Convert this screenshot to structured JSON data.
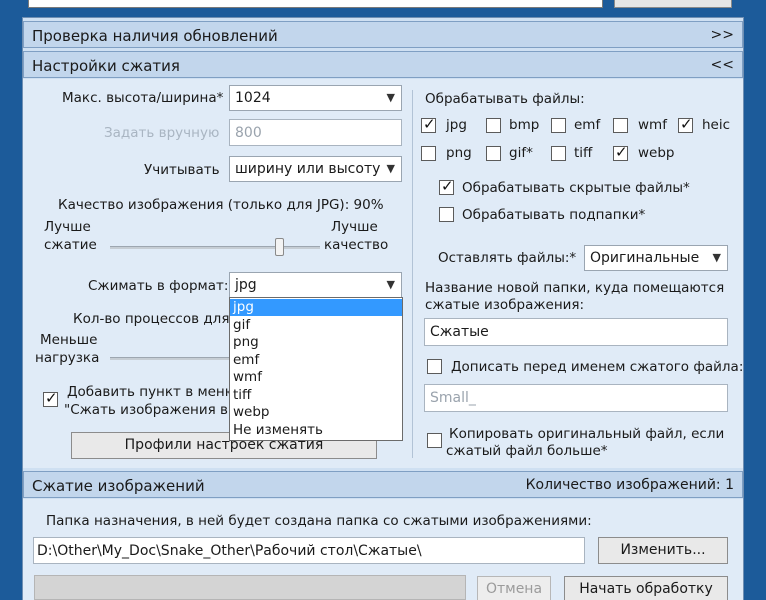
{
  "sections": {
    "updates": {
      "title": "Проверка наличия обновлений",
      "toggle": ">>"
    },
    "settings": {
      "title": "Настройки сжатия",
      "toggle": "<<"
    },
    "compress": {
      "title": "Сжатие изображений",
      "count_label": "Количество изображений: 1"
    }
  },
  "left": {
    "max_size_label": "Макс. высота/ширина*",
    "max_size_value": "1024",
    "manual_label": "Задать вручную",
    "manual_value": "800",
    "consider_label": "Учитывать",
    "consider_value": "ширину или высоту",
    "quality_label": "Качество изображения (только для JPG): 90%",
    "quality_value": 90,
    "better_compress": "Лучше сжатие",
    "better_compress_l1": "Лучше",
    "better_compress_l2": "сжатие",
    "better_quality_l1": "Лучше",
    "better_quality_l2": "качество",
    "format_label": "Сжимать в формат:",
    "format_value": "jpg",
    "processes_label": "Кол-во процессов для",
    "less_load_l1": "Меньше",
    "less_load_l2": "нагрузка",
    "context_menu_l1": "Добавить пункт в меню",
    "context_menu_l2": "\"Сжать изображения в п",
    "profiles_button": "Профили настроек сжатия"
  },
  "format_dropdown": [
    "jpg",
    "gif",
    "png",
    "emf",
    "wmf",
    "tiff",
    "webp",
    "Не изменять"
  ],
  "right": {
    "process_files_label": "Обрабатывать файлы:",
    "filetypes": [
      {
        "name": "jpg",
        "checked": true
      },
      {
        "name": "bmp",
        "checked": false
      },
      {
        "name": "emf",
        "checked": false
      },
      {
        "name": "wmf",
        "checked": false
      },
      {
        "name": "heic",
        "checked": true
      },
      {
        "name": "png",
        "checked": false
      },
      {
        "name": "gif*",
        "checked": false
      },
      {
        "name": "tiff",
        "checked": false
      },
      {
        "name": "webp",
        "checked": true
      }
    ],
    "hidden_files": "Обрабатывать скрытые файлы*",
    "subfolders": "Обрабатывать подпапки*",
    "keep_files_label": "Оставлять файлы:*",
    "keep_files_value": "Оригинальные",
    "folder_name_l1": "Название новой папки, куда помещаются",
    "folder_name_l2": "сжатые изображения:",
    "folder_name_value": "Сжатые",
    "prefix_label": "Дописать перед именем сжатого файла:",
    "prefix_value": "Small_",
    "copy_l1": "Копировать оригинальный файл, если",
    "copy_l2": "сжатый файл больше*"
  },
  "bottom": {
    "dest_label": "Папка назначения, в ней будет создана папка со сжатыми изображениями:",
    "dest_path": "D:\\Other\\My_Doc\\Snake_Other\\Рабочий стол\\Сжатые\\",
    "change_button": "Изменить...",
    "cancel_button": "Отмена",
    "start_button": "Начать обработку"
  }
}
